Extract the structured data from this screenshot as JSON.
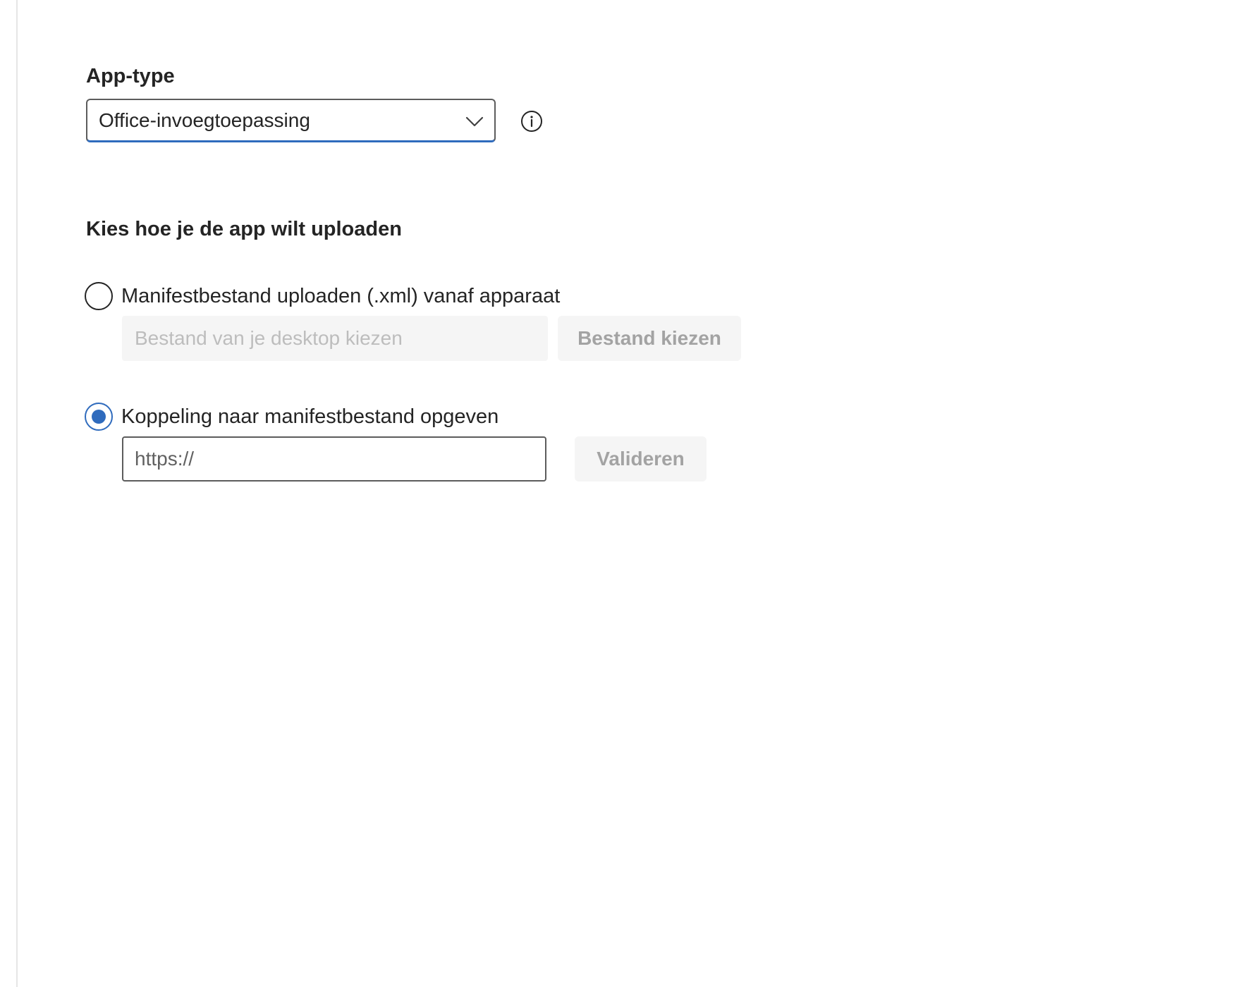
{
  "app_type": {
    "label": "App-type",
    "selected": "Office-invoegtoepassing"
  },
  "upload": {
    "section_title": "Kies hoe je de app wilt uploaden",
    "options": [
      {
        "label": "Manifestbestand uploaden (.xml) vanaf apparaat",
        "checked": false,
        "input_placeholder": "Bestand van je desktop kiezen",
        "button_label": "Bestand kiezen"
      },
      {
        "label": "Koppeling naar manifestbestand opgeven",
        "checked": true,
        "input_placeholder": "https://",
        "button_label": "Valideren"
      }
    ]
  },
  "icons": {
    "dropdown": "chevron-down-icon",
    "info": "info-icon"
  },
  "colors": {
    "accent": "#2f6bbd",
    "disabled_bg": "#f5f5f5",
    "disabled_text": "#a3a3a3"
  }
}
